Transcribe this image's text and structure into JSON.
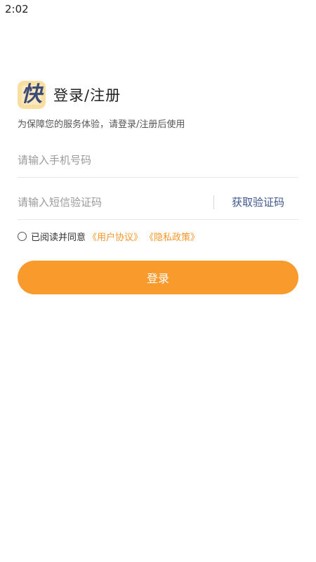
{
  "status_bar": {
    "time": "2:02"
  },
  "header": {
    "logo_char": "快",
    "title": "登录/注册",
    "subtitle": "为保障您的服务体验，请登录/注册后使用"
  },
  "form": {
    "phone_placeholder": "请输入手机号码",
    "code_placeholder": "请输入短信验证码",
    "get_code_label": "获取验证码"
  },
  "agreement": {
    "prefix": "已阅读并同意",
    "user_agreement": "《用户协议》",
    "privacy_policy": "《隐私政策》",
    "checked": false
  },
  "login_label": "登录",
  "colors": {
    "accent": "#F89A2C",
    "link": "#F7962A",
    "code_button": "#3E568E",
    "logo_bg": "#F9DEA2",
    "logo_char": "#3C4A77"
  }
}
